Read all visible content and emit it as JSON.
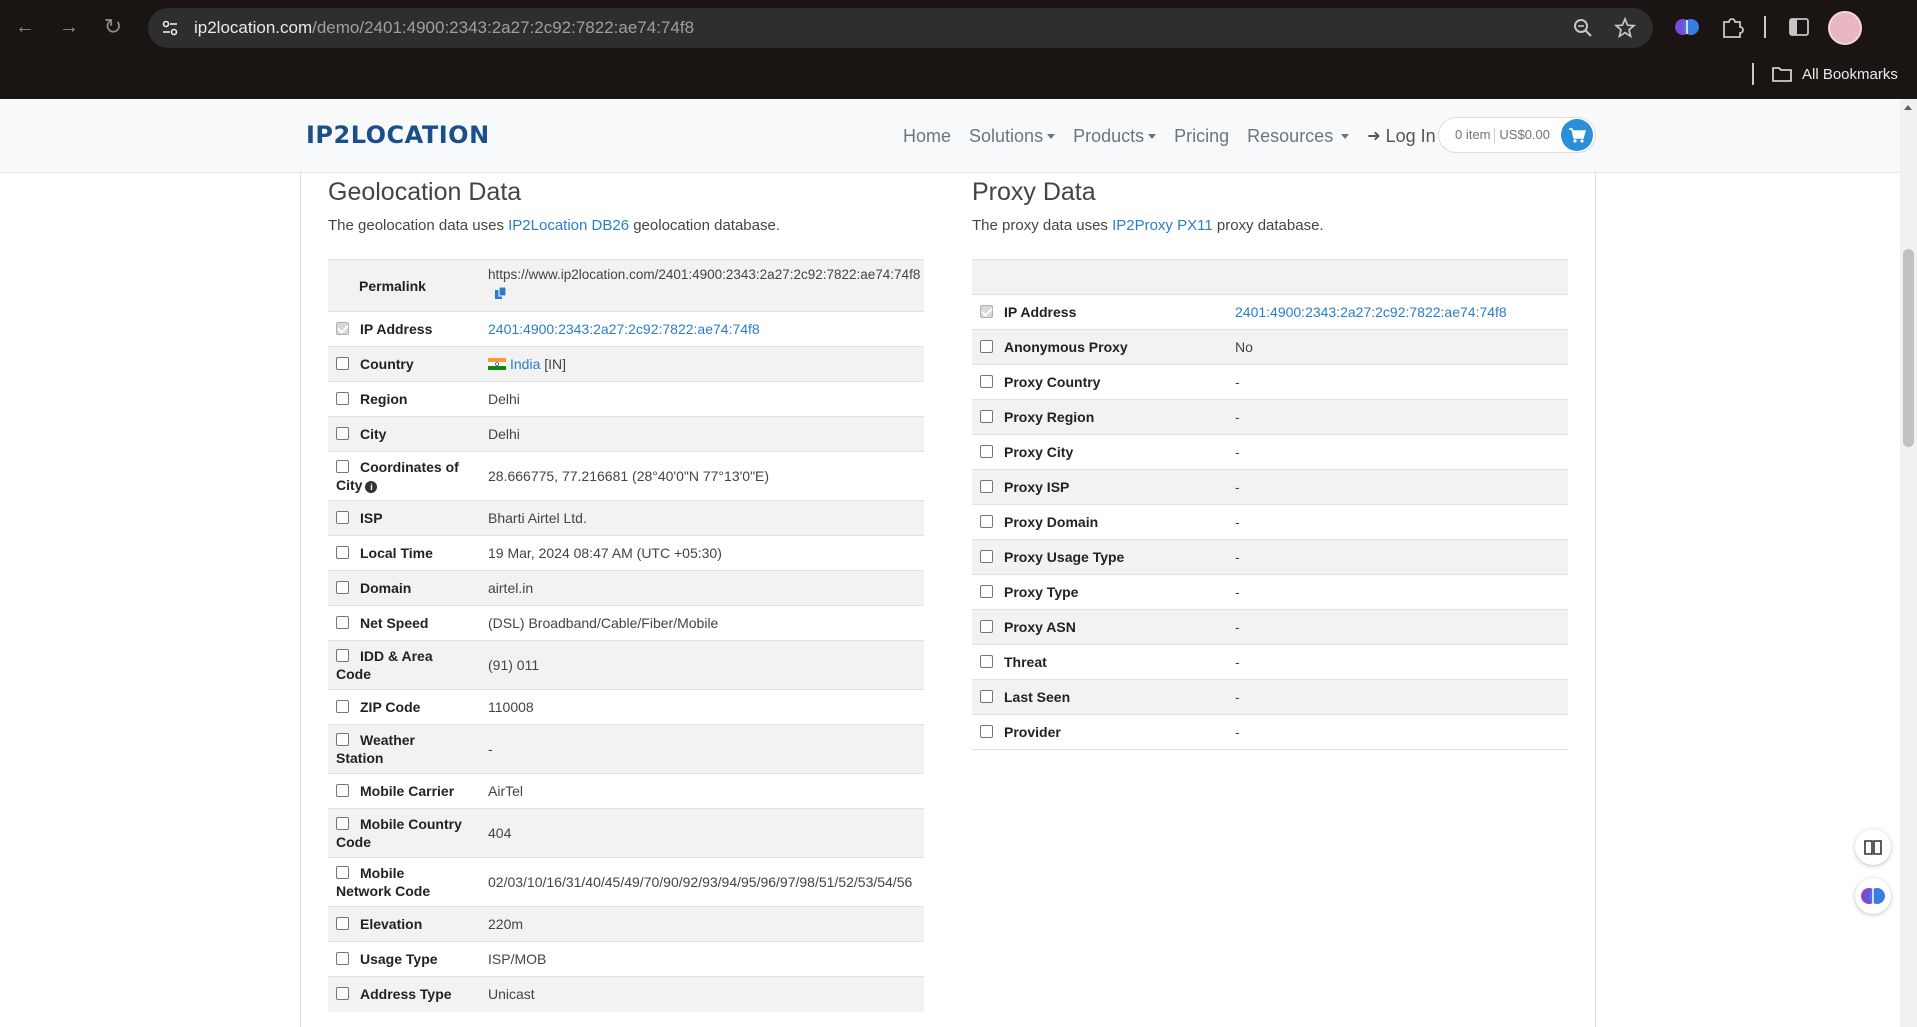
{
  "browser": {
    "url_host": "ip2location.com",
    "url_path": "/demo/2401:4900:2343:2a27:2c92:7822:ae74:74f8",
    "bookmarks_label": "All Bookmarks",
    "icons": [
      "back-icon",
      "forward-icon",
      "reload-icon",
      "site-settings-icon",
      "zoom-icon",
      "star-icon",
      "extension-brain-icon",
      "extensions-puzzle-icon",
      "side-panel-icon",
      "profile-avatar"
    ]
  },
  "site_nav": {
    "logo": "IP2LOCATION",
    "links": {
      "home": "Home",
      "solutions": "Solutions",
      "products": "Products",
      "pricing": "Pricing",
      "resources": "Resources",
      "login": "Log In"
    },
    "cart_items": "0 item",
    "cart_total": "US$0.00"
  },
  "geolocation": {
    "title": "Geolocation Data",
    "desc_pre": "The geolocation data uses ",
    "desc_link": "IP2Location DB26",
    "desc_post": " geolocation database.",
    "permalink_label": "Permalink",
    "permalink_value": "https://www.ip2location.com/2401:4900:2343:2a27:2c92:7822:ae74:74f8",
    "ip_label": "IP Address",
    "ip_value": "2401:4900:2343:2a27:2c92:7822:ae74:74f8",
    "country_label": "Country",
    "country_name": "India",
    "country_code": "[IN]",
    "rows": [
      {
        "label": "Region",
        "value": "Delhi"
      },
      {
        "label": "City",
        "value": "Delhi"
      },
      {
        "label": "Coordinates of City",
        "value": "28.666775, 77.216681 (28°40'0\"N   77°13'0\"E)"
      },
      {
        "label": "ISP",
        "value": "Bharti Airtel Ltd."
      },
      {
        "label": "Local Time",
        "value": "19 Mar, 2024 08:47 AM (UTC +05:30)"
      },
      {
        "label": "Domain",
        "value": "airtel.in"
      },
      {
        "label": "Net Speed",
        "value": "(DSL) Broadband/Cable/Fiber/Mobile"
      },
      {
        "label": "IDD & Area Code",
        "value": "(91) 011"
      },
      {
        "label": "ZIP Code",
        "value": "110008"
      },
      {
        "label": "Weather Station",
        "value": "-"
      },
      {
        "label": "Mobile Carrier",
        "value": "AirTel"
      },
      {
        "label": "Mobile Country Code",
        "value": "404"
      },
      {
        "label": "Mobile Network Code",
        "value": "02/03/10/16/31/40/45/49/70/90/92/93/94/95/96/97/98/51/52/53/54/56"
      },
      {
        "label": "Elevation",
        "value": "220m"
      },
      {
        "label": "Usage Type",
        "value": "ISP/MOB"
      },
      {
        "label": "Address Type",
        "value": "Unicast"
      }
    ]
  },
  "proxy": {
    "title": "Proxy Data",
    "desc_pre": "The proxy data uses ",
    "desc_link": "IP2Proxy PX11",
    "desc_post": " proxy database.",
    "ip_label": "IP Address",
    "ip_value": "2401:4900:2343:2a27:2c92:7822:ae74:74f8",
    "rows": [
      {
        "label": "Anonymous Proxy",
        "value": "No"
      },
      {
        "label": "Proxy Country",
        "value": "-"
      },
      {
        "label": "Proxy Region",
        "value": "-"
      },
      {
        "label": "Proxy City",
        "value": "-"
      },
      {
        "label": "Proxy ISP",
        "value": "-"
      },
      {
        "label": "Proxy Domain",
        "value": "-"
      },
      {
        "label": "Proxy Usage Type",
        "value": "-"
      },
      {
        "label": "Proxy Type",
        "value": "-"
      },
      {
        "label": "Proxy ASN",
        "value": "-"
      },
      {
        "label": "Threat",
        "value": "-"
      },
      {
        "label": "Last Seen",
        "value": "-"
      },
      {
        "label": "Provider",
        "value": "-"
      }
    ]
  },
  "colors": {
    "link": "#2a7ec9",
    "logo": "#1b4f8a",
    "cart_button": "#2a8fd6",
    "row_stripe": "#f2f2f2"
  }
}
